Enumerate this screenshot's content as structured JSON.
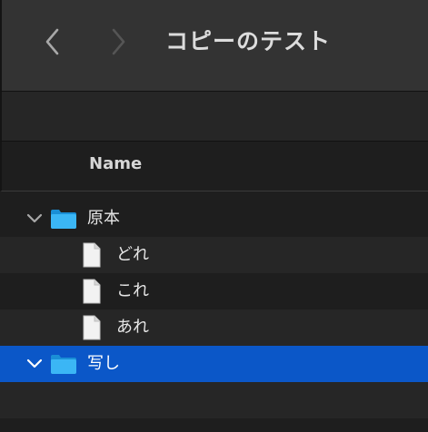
{
  "window": {
    "title": "コピーのテスト"
  },
  "nav": {
    "back_icon": "chevron-left-icon",
    "forward_icon": "chevron-right-icon"
  },
  "columns": {
    "name_header": "Name"
  },
  "tree": [
    {
      "label": "原本",
      "kind": "folder",
      "expanded": true,
      "selected": false,
      "depth": 0
    },
    {
      "label": "どれ",
      "kind": "file",
      "selected": false,
      "depth": 1
    },
    {
      "label": "これ",
      "kind": "file",
      "selected": false,
      "depth": 1
    },
    {
      "label": "あれ",
      "kind": "file",
      "selected": false,
      "depth": 1
    },
    {
      "label": "写し",
      "kind": "folder",
      "expanded": true,
      "selected": true,
      "depth": 0
    }
  ],
  "colors": {
    "titlebar": "#333333",
    "background": "#1e1e1e",
    "alternate_row": "#262626",
    "selection": "#0b57c8",
    "folder": "#1ea7f0"
  }
}
